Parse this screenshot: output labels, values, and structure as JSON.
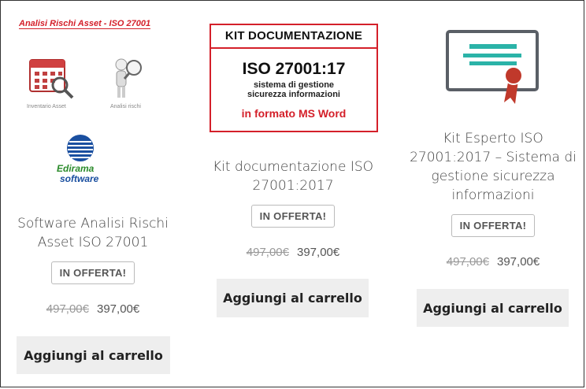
{
  "products": [
    {
      "image": {
        "header": "Analisi Rischi Asset - ISO 27001",
        "icon1_label": "Inventario Asset",
        "icon2_label": "Analisi rischi",
        "logo_line1": "Edirama",
        "logo_line2": "software"
      },
      "title_line1": "Software Analisi Rischi",
      "title_line2": "Asset ISO 27001",
      "badge": "IN OFFERTA!",
      "old_price": "497,00€",
      "price": "397,00€",
      "button": "Aggiungi al carrello"
    },
    {
      "image": {
        "header": "KIT DOCUMENTAZIONE",
        "big": "ISO 27001:17",
        "sub1": "sistema di gestione",
        "sub2": "sicurezza informazioni",
        "footer": "in formato MS Word"
      },
      "title_line1": "Kit documentazione ISO",
      "title_line2": "27001:2017",
      "badge": "IN OFFERTA!",
      "old_price": "497,00€",
      "price": "397,00€",
      "button": "Aggiungi al carrello"
    },
    {
      "title_line1": "Kit Esperto ISO",
      "title_line2": "27001:2017 – Sistema di",
      "title_line3": "gestione sicurezza",
      "title_line4": "informazioni",
      "badge": "IN OFFERTA!",
      "old_price": "497,00€",
      "price": "397,00€",
      "button": "Aggiungi al carrello"
    }
  ],
  "colors": {
    "accent_red": "#d4202a",
    "icon_teal": "#2bb3a8",
    "icon_gray": "#5a5f66",
    "button_bg": "#eeeeee"
  }
}
